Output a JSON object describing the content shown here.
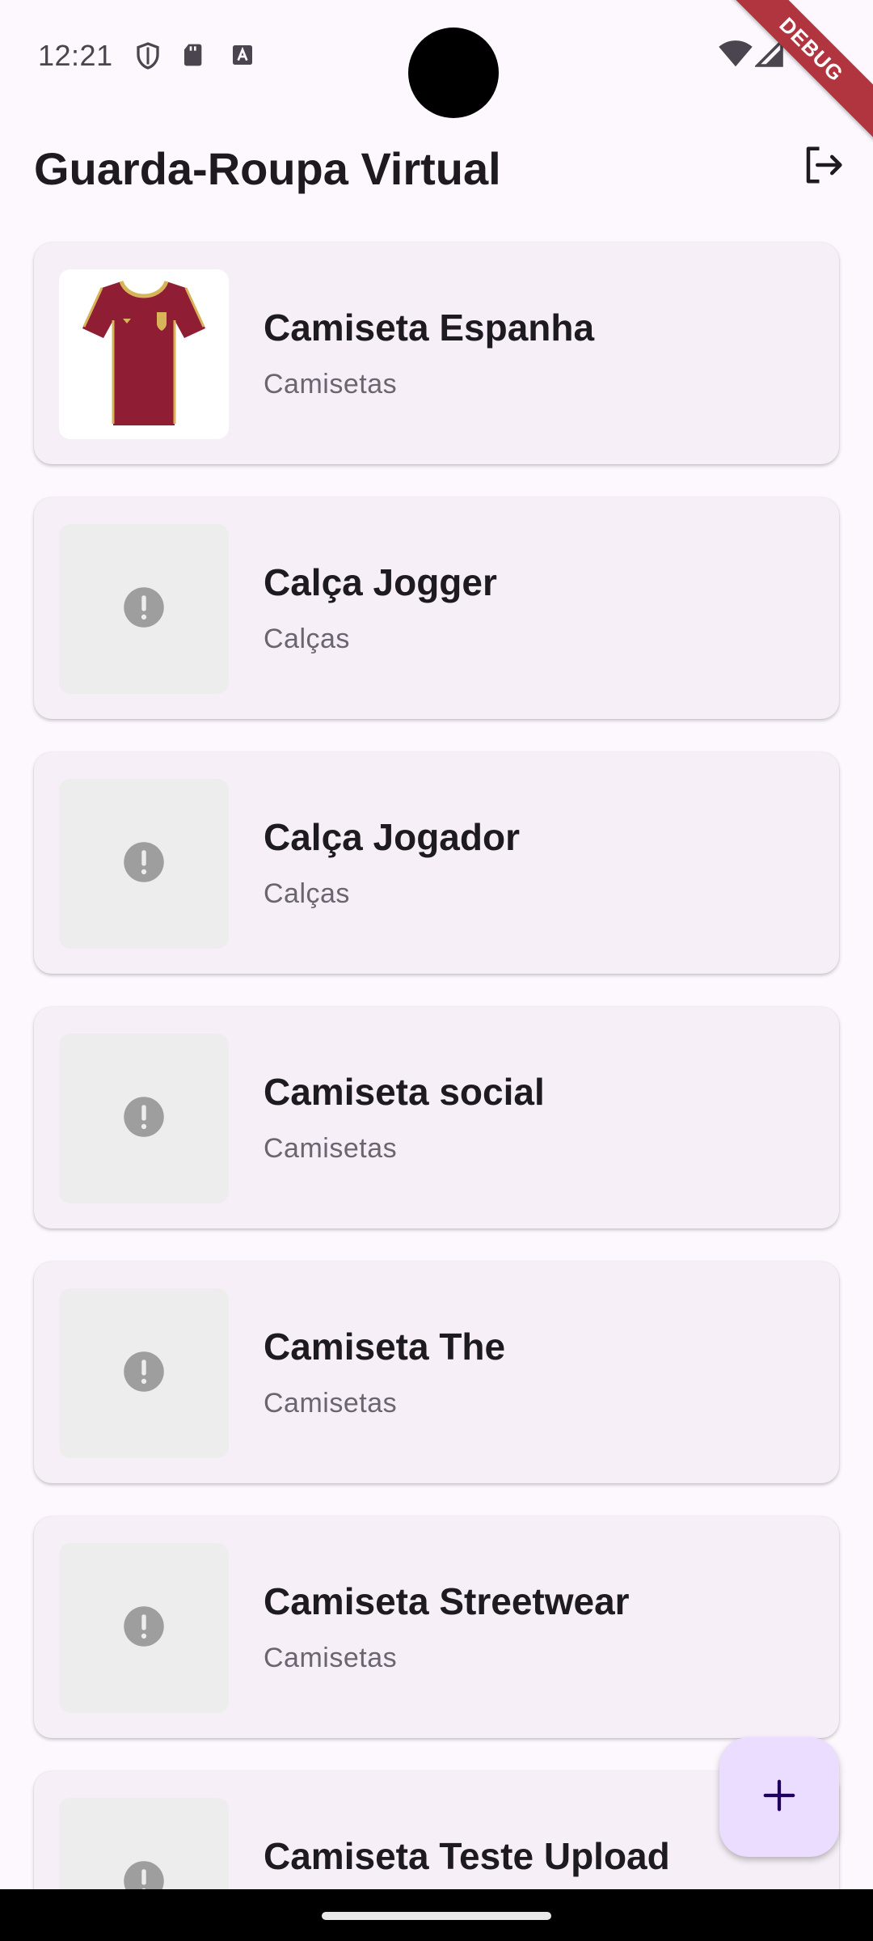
{
  "status_bar": {
    "time": "12:21",
    "debug_label": "DEBUG"
  },
  "app_bar": {
    "title": "Guarda-Roupa Virtual",
    "logout_icon": "logout-icon"
  },
  "items": [
    {
      "name": "Camiseta Espanha",
      "category": "Camisetas",
      "image": "jersey-photo"
    },
    {
      "name": "Calça Jogger",
      "category": "Calças",
      "image": "error-icon"
    },
    {
      "name": "Calça Jogador",
      "category": "Calças",
      "image": "error-icon"
    },
    {
      "name": "Camiseta social",
      "category": "Camisetas",
      "image": "error-icon"
    },
    {
      "name": "Camiseta The",
      "category": "Camisetas",
      "image": "error-icon"
    },
    {
      "name": "Camiseta Streetwear",
      "category": "Camisetas",
      "image": "error-icon"
    },
    {
      "name": "Camiseta Teste Upload",
      "category": "",
      "image": "error-icon"
    }
  ],
  "fab": {
    "icon": "plus-icon"
  },
  "colors": {
    "background": "#fdf7fe",
    "card": "#f6eff7",
    "fab": "#eaddff",
    "placeholder": "#ededed",
    "error_icon": "#9e9e9e",
    "debug_banner": "#b0353f"
  }
}
